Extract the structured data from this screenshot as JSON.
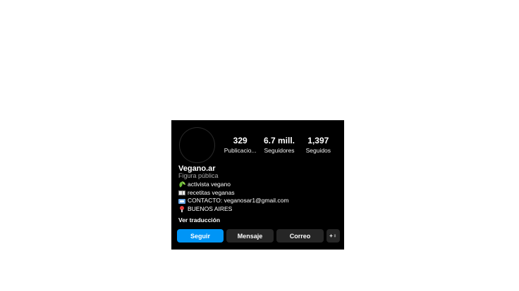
{
  "profile": {
    "name": "Vegano.ar",
    "category": "Figura pública",
    "stats": [
      {
        "value": "329",
        "label": "Publicacio..."
      },
      {
        "value": "6.7 mill.",
        "label": "Seguidores"
      },
      {
        "value": "1,397",
        "label": "Seguidos"
      }
    ],
    "bio": [
      {
        "icon": "sprout-icon",
        "text": "activista vegano"
      },
      {
        "icon": "book-icon",
        "text": "recetitas veganas"
      },
      {
        "icon": "envelope-icon",
        "text": "CONTACTO: veganosar1@gmail.com"
      },
      {
        "icon": "pin-icon",
        "text": "BUENOS AIRES"
      }
    ],
    "translate_label": "Ver traducción"
  },
  "actions": {
    "follow_label": "Seguir",
    "message_label": "Mensaje",
    "email_label": "Correo",
    "suggest_icon_label": "+♀"
  },
  "colors": {
    "follow_button": "#0095f6",
    "secondary_button": "#262626",
    "card_background": "#000000"
  }
}
